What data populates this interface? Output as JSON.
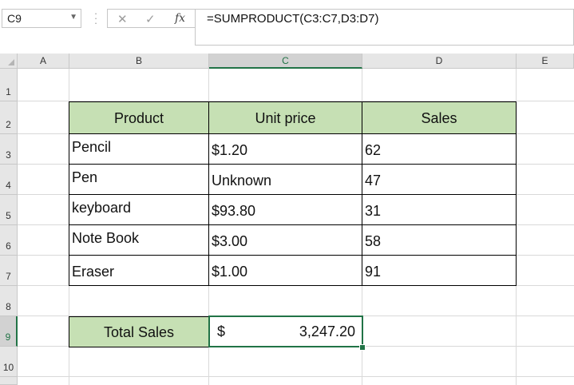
{
  "formula_bar": {
    "name_box": "C9",
    "formula": "=SUMPRODUCT(C3:C7,D3:D7)",
    "cancel_icon": "✕",
    "enter_icon": "✓",
    "fx_icon": "fx"
  },
  "columns": [
    "A",
    "B",
    "C",
    "D",
    "E"
  ],
  "rows": [
    "1",
    "2",
    "3",
    "4",
    "5",
    "6",
    "7",
    "8",
    "9",
    "10"
  ],
  "selected": {
    "column": "C",
    "row": "9"
  },
  "table": {
    "headers": [
      "Product",
      "Unit price",
      "Sales"
    ],
    "rows": [
      [
        "Pencil",
        "$1.20",
        "62"
      ],
      [
        "Pen",
        "Unknown",
        "47"
      ],
      [
        "keyboard",
        "$93.80",
        "31"
      ],
      [
        "Note Book",
        "$3.00",
        "58"
      ],
      [
        "Eraser",
        "$1.00",
        "91"
      ]
    ]
  },
  "total": {
    "label": "Total Sales",
    "currency": "$",
    "value": "3,247.20"
  },
  "colors": {
    "header_fill": "#c6e0b4",
    "selection": "#217346"
  }
}
